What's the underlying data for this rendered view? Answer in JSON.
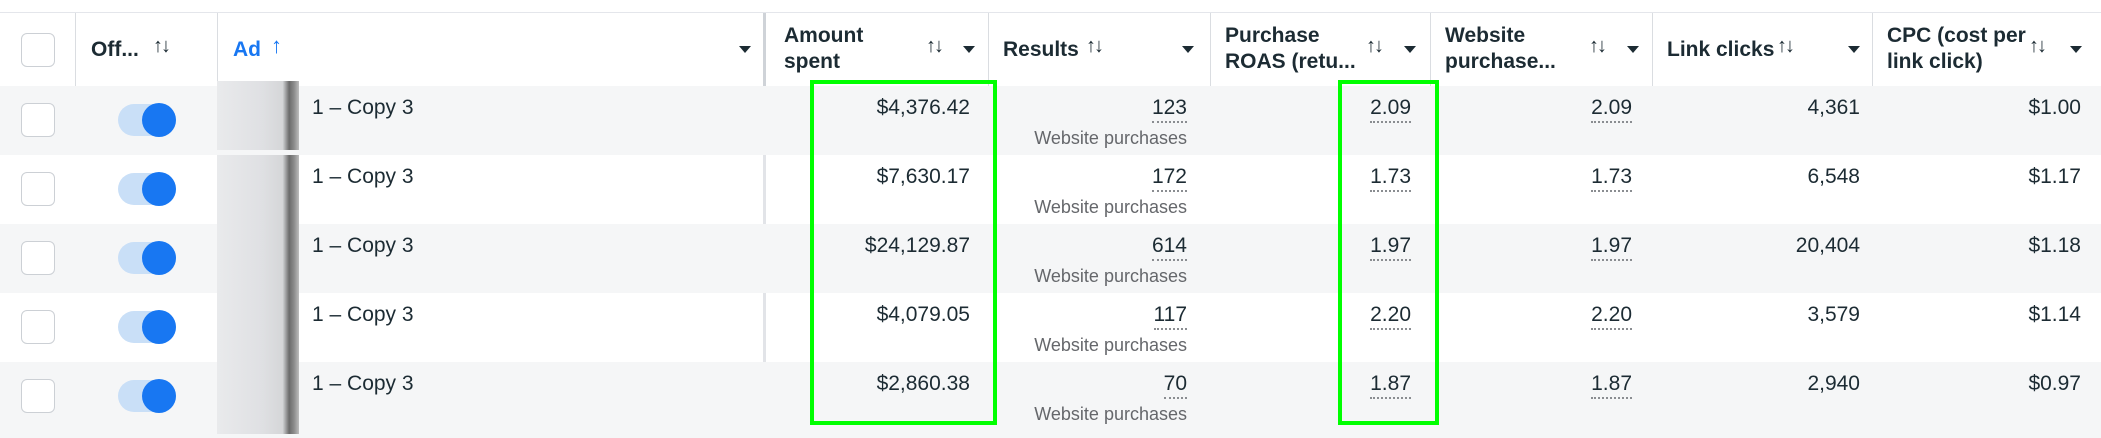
{
  "columns": {
    "off": "Off...",
    "ad": "Ad",
    "amount_spent": "Amount\nspent",
    "results": "Results",
    "purchase_roas": "Purchase\nROAS (retu...",
    "website_purchase": "Website\npurchase...",
    "link_clicks": "Link clicks",
    "cpc": "CPC (cost per\nlink click)"
  },
  "icons": {
    "sort": "sort-arrows-icon",
    "sort_asc": "arrow-up-icon",
    "menu": "chevron-down-icon"
  },
  "colors": {
    "highlight": "#00ff00",
    "toggle_on": "#1877f2",
    "sorted_header": "#1877f2"
  },
  "rows": [
    {
      "ad": "1 – Copy 3",
      "on": true,
      "amount_spent": "$4,376.42",
      "results": "123",
      "results_sub": "Website purchases",
      "purchase_roas": "2.09",
      "website_purchase": "2.09",
      "link_clicks": "4,361",
      "cpc": "$1.00"
    },
    {
      "ad": "1 – Copy 3",
      "on": true,
      "amount_spent": "$7,630.17",
      "results": "172",
      "results_sub": "Website purchases",
      "purchase_roas": "1.73",
      "website_purchase": "1.73",
      "link_clicks": "6,548",
      "cpc": "$1.17"
    },
    {
      "ad": "1 – Copy 3",
      "on": true,
      "amount_spent": "$24,129.87",
      "results": "614",
      "results_sub": "Website purchases",
      "purchase_roas": "1.97",
      "website_purchase": "1.97",
      "link_clicks": "20,404",
      "cpc": "$1.18"
    },
    {
      "ad": "1 – Copy 3",
      "on": true,
      "amount_spent": "$4,079.05",
      "results": "117",
      "results_sub": "Website purchases",
      "purchase_roas": "2.20",
      "website_purchase": "2.20",
      "link_clicks": "3,579",
      "cpc": "$1.14"
    },
    {
      "ad": "1 – Copy 3",
      "on": true,
      "amount_spent": "$2,860.38",
      "results": "70",
      "results_sub": "Website purchases",
      "purchase_roas": "1.87",
      "website_purchase": "1.87",
      "link_clicks": "2,940",
      "cpc": "$0.97"
    }
  ]
}
